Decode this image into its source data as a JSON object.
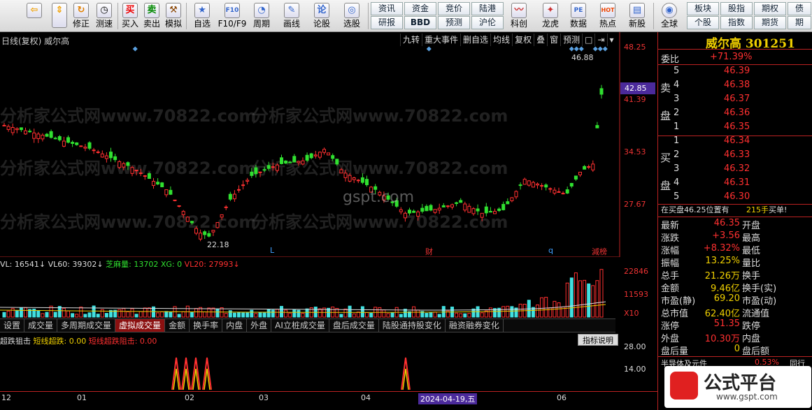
{
  "toolbar": {
    "buttons": [
      {
        "label": "",
        "icon": "back-arrow-icon"
      },
      {
        "label": "",
        "icon": "up-down-icon"
      },
      {
        "label": "修正",
        "icon": "fix-icon"
      },
      {
        "label": "测速",
        "icon": "clock-icon"
      },
      {
        "label": "买入",
        "icon": "buy-icon"
      },
      {
        "label": "卖出",
        "icon": "sell-icon"
      },
      {
        "label": "模拟",
        "icon": "hammer-icon"
      },
      {
        "label": "自选",
        "icon": "star-icon"
      },
      {
        "label": "F10/F9",
        "icon": "f10-icon"
      },
      {
        "label": "周期",
        "icon": "period-icon"
      },
      {
        "label": "画线",
        "icon": "pencil-icon"
      },
      {
        "label": "论股",
        "icon": "forum-icon"
      },
      {
        "label": "选股",
        "icon": "stock-pick-icon"
      },
      {
        "label": "科创",
        "icon": "kechuang-icon"
      },
      {
        "label": "龙虎",
        "icon": "dragon-tiger-icon"
      },
      {
        "label": "数据",
        "icon": "pe-icon"
      },
      {
        "label": "热点",
        "icon": "hot-icon"
      },
      {
        "label": "新股",
        "icon": "new-stock-icon"
      },
      {
        "label": "全球",
        "icon": "globe-icon"
      }
    ],
    "grid_left": [
      "资讯",
      "资金",
      "竞价",
      "陆港",
      "研报",
      "BBD",
      "预测",
      "沪伦"
    ],
    "grid_right": [
      "板块",
      "股指",
      "期权",
      "债",
      "个股",
      "指数",
      "期货",
      "期"
    ],
    "icon_keys": {
      "buy": "买",
      "sell": "卖",
      "f10": "F10",
      "pe": "PE",
      "hot": "HOT"
    }
  },
  "chart": {
    "title": "日线(复权) 威尔高",
    "tabs": [
      "九转",
      "重大事件",
      "删自选",
      "均线",
      "复权",
      "叠",
      "窗",
      "预测",
      "□",
      "⇥",
      "▾"
    ],
    "price_labels": [
      "48.25",
      "41.39",
      "34.53",
      "27.67"
    ],
    "current_tag": "42.85",
    "high_marker": "46.88",
    "low_marker": "22.18",
    "event_marks": [
      "L",
      "财",
      "q",
      "減榜"
    ],
    "volume_header": {
      "a": "VL: 16541↓",
      "b": "VL60: 39302↓",
      "c": "芝麻量: 13702",
      "d": "XG: 0",
      "e": "VL20: 27993↓"
    },
    "volume_labels": [
      "22846",
      "11593",
      "X10"
    ],
    "indicator_tabs": [
      "设置",
      "成交量",
      "多周期成交量",
      "虚拟成交量",
      "金额",
      "换手率",
      "内盘",
      "外盘",
      "AI立桩成交量",
      "盘后成交量",
      "陆股通持股变化",
      "融资融券变化"
    ],
    "active_indicator": "虚拟成交量",
    "indicator_header": {
      "a": "超跌狙击",
      "b": "短线超跌: 0.00",
      "c": "短线超跌阻击: 0.00"
    },
    "indicator_button": "指标说明",
    "indicator_labels": [
      "28.00",
      "14.00"
    ],
    "time_axis": [
      "12",
      "01",
      "02",
      "03",
      "04",
      "2024-04-19,五",
      "06"
    ],
    "watermark": "gspt.com",
    "bg_watermark": "分析家公式网www.70822.com"
  },
  "quote": {
    "name": "威尔高",
    "code": "301251",
    "weibi_label": "委比",
    "weibi": "+71.39%",
    "sell_label": "卖盘",
    "buy_label": "买盘",
    "sell": [
      {
        "lvl": "5",
        "price": "46.39"
      },
      {
        "lvl": "4",
        "price": "46.38"
      },
      {
        "lvl": "3",
        "price": "46.37"
      },
      {
        "lvl": "2",
        "price": "46.36"
      },
      {
        "lvl": "1",
        "price": "46.35"
      }
    ],
    "buy": [
      {
        "lvl": "1",
        "price": "46.34"
      },
      {
        "lvl": "2",
        "price": "46.33"
      },
      {
        "lvl": "3",
        "price": "46.32"
      },
      {
        "lvl": "4",
        "price": "46.31"
      },
      {
        "lvl": "5",
        "price": "46.30"
      }
    ],
    "r_tag": "R",
    "queue_text": "在买盘46.25位置有",
    "queue_qty": "215手",
    "queue_side": "买单!",
    "stats": [
      {
        "k1": "最新",
        "v1": "46.35",
        "k2": "开盘",
        "v2": ""
      },
      {
        "k1": "涨跌",
        "v1": "+3.56",
        "k2": "最高",
        "v2": ""
      },
      {
        "k1": "涨幅",
        "v1": "+8.32%",
        "k2": "最低",
        "v2": ""
      },
      {
        "k1": "振幅",
        "v1": "13.25%",
        "k2": "量比",
        "v2": ""
      },
      {
        "k1": "总手",
        "v1": "21.26万",
        "k2": "换手",
        "v2": ""
      },
      {
        "k1": "金额",
        "v1": "9.46亿",
        "k2": "换手(实)",
        "v2": ""
      },
      {
        "k1": "市盈(静)",
        "v1": "69.20",
        "k2": "市盈(动)",
        "v2": ""
      },
      {
        "k1": "总市值",
        "v1": "62.40亿",
        "k2": "流通值",
        "v2": ""
      },
      {
        "k1": "涨停",
        "v1": "51.35",
        "k2": "跌停",
        "v2": ""
      },
      {
        "k1": "外盘",
        "v1": "10.30万",
        "k2": "内盘",
        "v2": ""
      },
      {
        "k1": "盘后量",
        "v1": "0",
        "k2": "盘后额",
        "v2": ""
      }
    ],
    "sector": "半导体及元件",
    "sector_pct": "0.53%",
    "sector_tail": "同行"
  },
  "logo": {
    "text": "公式平台",
    "url": "www.gspt.com"
  },
  "colors": {
    "up": "#ff3030",
    "down": "#30e030",
    "cyan": "#40e0e0",
    "yellow": "#f0d000",
    "accent": "#4b2a9b"
  }
}
